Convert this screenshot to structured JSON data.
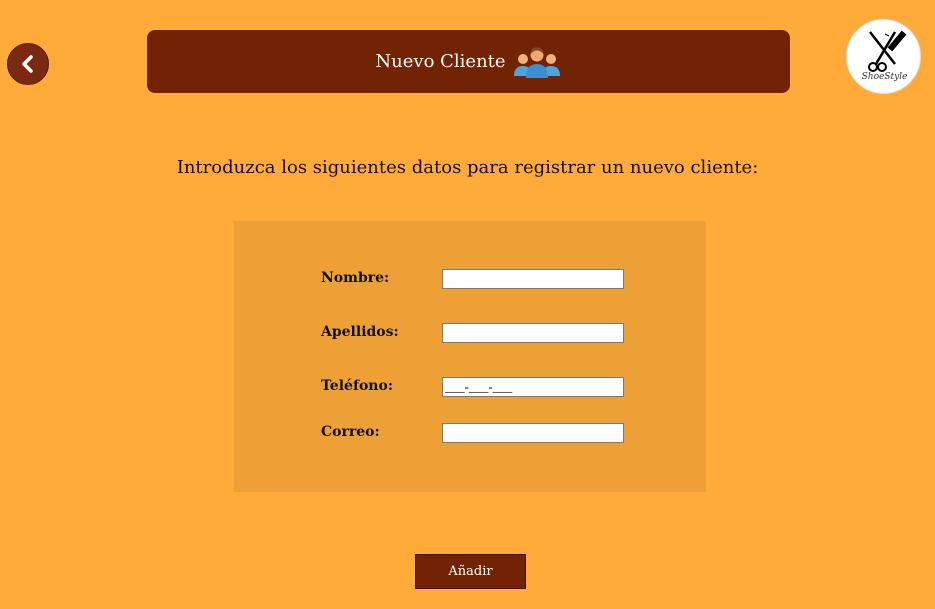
{
  "header": {
    "title": "Nuevo Cliente"
  },
  "logo": {
    "brand_text": "ShoeStyle"
  },
  "intro": {
    "text": "Introduzca los siguientes datos para registrar un nuevo cliente:"
  },
  "form": {
    "fields": [
      {
        "label": "Nombre:",
        "value": ""
      },
      {
        "label": "Apellidos:",
        "value": ""
      },
      {
        "label": "Teléfono:",
        "value": "___-___-___"
      },
      {
        "label": "Correo:",
        "value": ""
      }
    ],
    "submit_label": "Añadir"
  },
  "colors": {
    "background": "#ffab3a",
    "header": "#722303",
    "panel": "#eda036",
    "button": "#722303"
  },
  "icons": {
    "back": "chevron-left-icon",
    "header": "group-icon",
    "logo": "scissors-comb-icon"
  }
}
